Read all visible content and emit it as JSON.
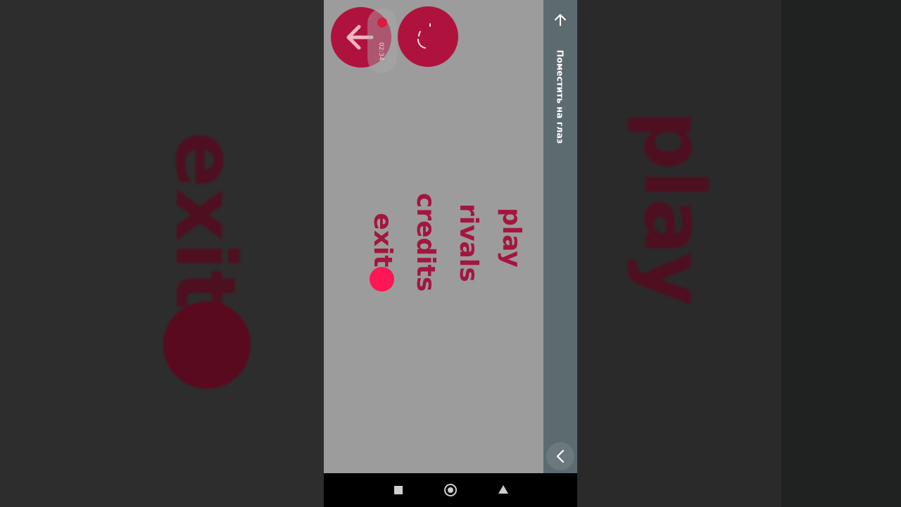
{
  "background": {
    "left_word": "exit",
    "right_word": "play"
  },
  "game": {
    "menu": [
      {
        "label": "play"
      },
      {
        "label": "rivals"
      },
      {
        "label": "credits"
      },
      {
        "label": "exit"
      }
    ],
    "selected_item": "exit",
    "back_button_icon": "arrow-left-icon",
    "restart_button_icon": "restart-icon",
    "accent_color": "#b0123e",
    "selector_color": "#ff1654"
  },
  "screen_recorder": {
    "time": "02:34"
  },
  "side_panel": {
    "label": "Поместить на глаз",
    "top_icon": "arrow-up-icon",
    "bottom_icon": "chevron-left-icon"
  },
  "system_nav": {
    "buttons": [
      "recents-icon",
      "home-icon",
      "back-icon"
    ]
  }
}
